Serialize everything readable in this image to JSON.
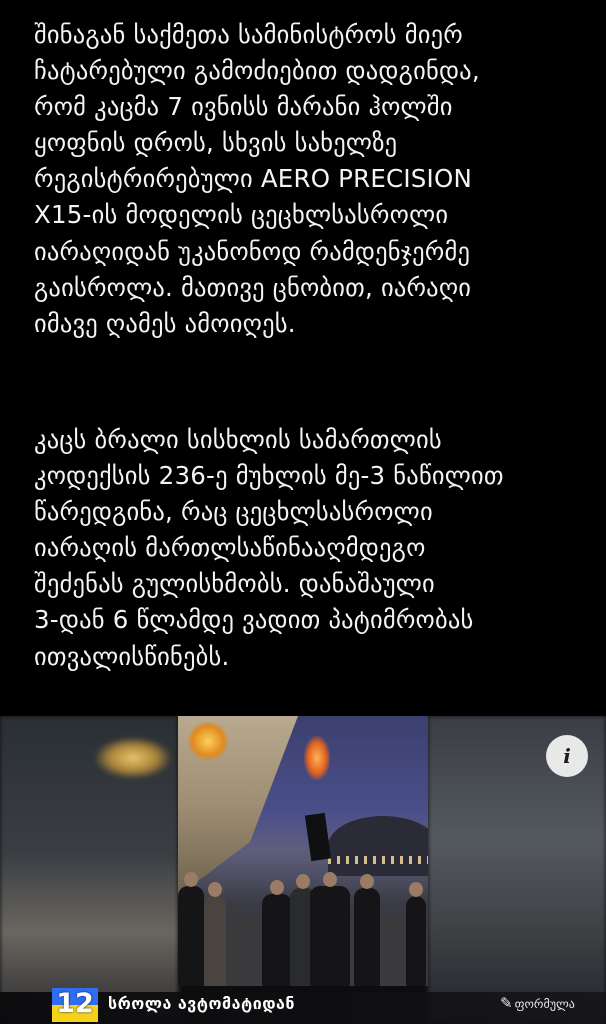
{
  "article": {
    "paragraphs": [
      "შინაგან საქმეთა სამინისტროს მიერ\nჩატარებული გამოძიებით დადგინდა,\nრომ კაცმა 7 ივნისს მარანი ჰოლში\nყოფნის დროს, სხვის სახელზე\nრეგისტრირებული AERO PRECISION\nX15-ის მოდელის ცეცხლსასროლი\nიარაღიდან უკანონოდ რამდენჯერმე\nგაისროლა. მათივე ცნობით, იარაღი\nიმავე ღამეს ამოიღეს.",
      "კაცს ბრალი სისხლის სამართლის\nკოდექსის 236-ე მუხლის მე-3 ნაწილით\nწარედგინა, რაც ცეცხლსასროლი\nიარაღის მართლსაწინააღმდეგო\nშეძენას გულისხმობს. დანაშაული\n3-დან 6 წლამდე ვადით პატიმრობას\nითვალისწინებს."
    ]
  },
  "video": {
    "info_icon": "info-icon",
    "info_symbol": "i",
    "channel_logo": "12",
    "ticker_text": "სროლა ავტომატიდან",
    "brand_mark": "✎",
    "brand_text": "ფორმულა"
  },
  "colors": {
    "background": "#000000",
    "text": "#f4f4f4",
    "logo_blue": "#2f6df2",
    "logo_yellow": "#f6d21a"
  }
}
